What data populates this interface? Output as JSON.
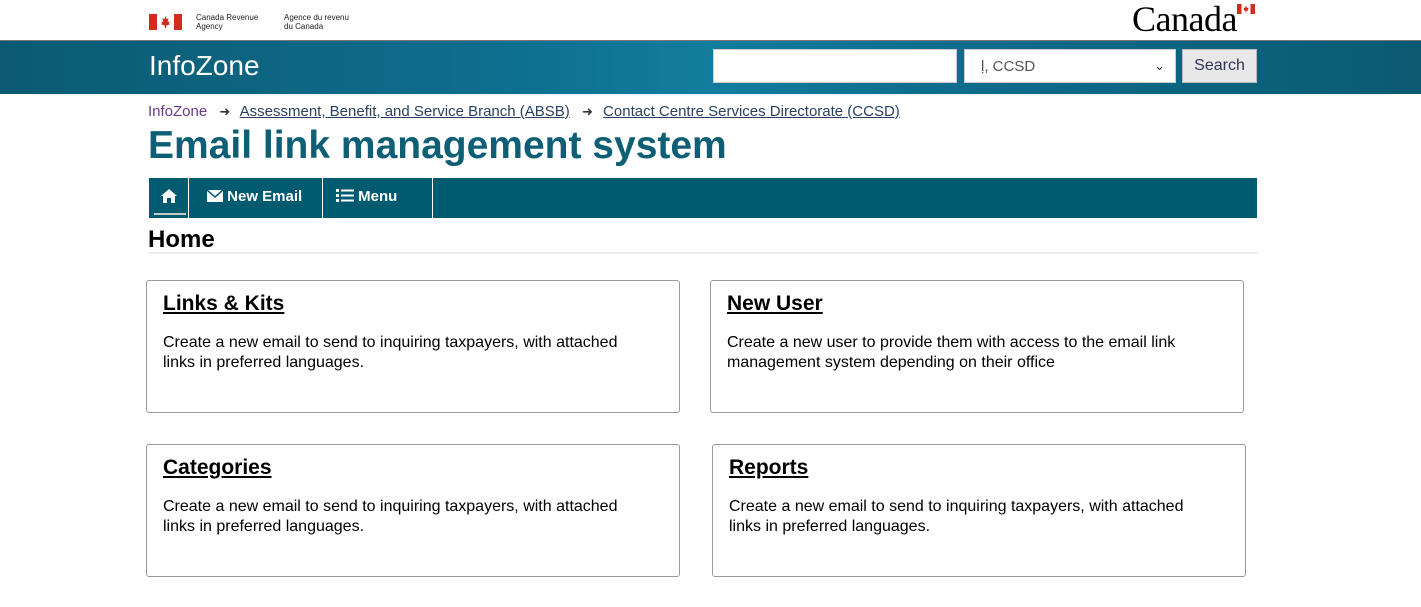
{
  "gov": {
    "dept_en_line1": "Canada Revenue",
    "dept_en_line2": "Agency",
    "dept_fr_line1": "Agence du revenu",
    "dept_fr_line2": "du Canada",
    "wordmark": "Canada"
  },
  "header": {
    "site_title": "InfoZone",
    "search_value": "",
    "directory_selected": "ḷ, CCSD",
    "search_button": "Search"
  },
  "breadcrumb": {
    "items": [
      "InfoZone",
      "Assessment, Benefit, and Service Branch (ABSB)",
      "Contact Centre Services Directorate (CCSD)"
    ],
    "separator": "➜"
  },
  "page": {
    "title": "Email link management system",
    "section_heading": "Home"
  },
  "nav": {
    "home_icon": "home-icon",
    "new_email_label": "New Email",
    "menu_label": "Menu"
  },
  "cards": [
    {
      "title": "Links & Kits",
      "description": "Create a new email to send to inquiring taxpayers, with attached links in preferred languages."
    },
    {
      "title": "New User",
      "description": "Create a new user to provide them with access to the email link management system depending on their office"
    },
    {
      "title": "Categories",
      "description": "Create a new email to send to inquiring taxpayers, with attached links in preferred languages."
    },
    {
      "title": "Reports",
      "description": "Create a new email to send to inquiring taxpayers, with attached links in preferred languages."
    }
  ],
  "colors": {
    "banner": "#0e6e8e",
    "nav": "#005a70",
    "title": "#0e5f75",
    "flag_red": "#d52b1e"
  }
}
